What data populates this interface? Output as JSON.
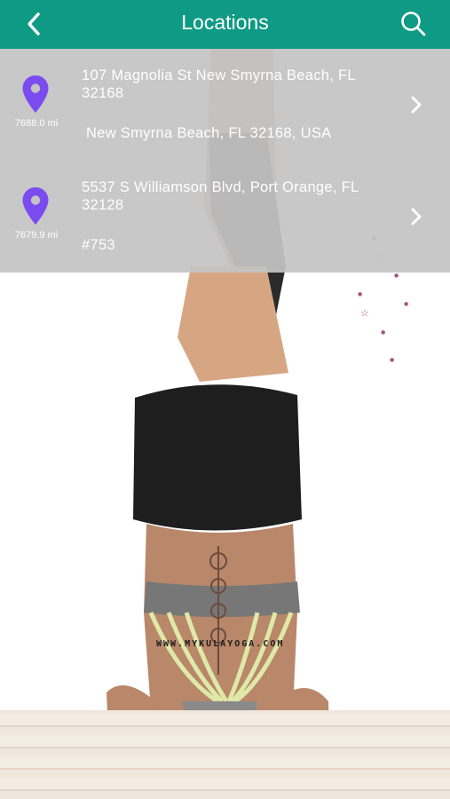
{
  "header": {
    "title": "Locations",
    "background_color": "#0f9a85",
    "back_icon": "chevron-left-icon",
    "search_icon": "search-icon"
  },
  "locations": [
    {
      "distance": "7688.0 mi",
      "address": "107 Magnolia St New Smyrna Beach, FL 32168",
      "detail": "New Smyrna Beach, FL 32168, USA"
    },
    {
      "distance": "7679.9 mi",
      "address": "5537 S Williamson Blvd, Port Orange, FL 32128",
      "detail": "#753"
    }
  ],
  "pin_color": "#7a4cf0",
  "background_image": {
    "watermark": "WWW.MYKULAYOGA.COM"
  }
}
